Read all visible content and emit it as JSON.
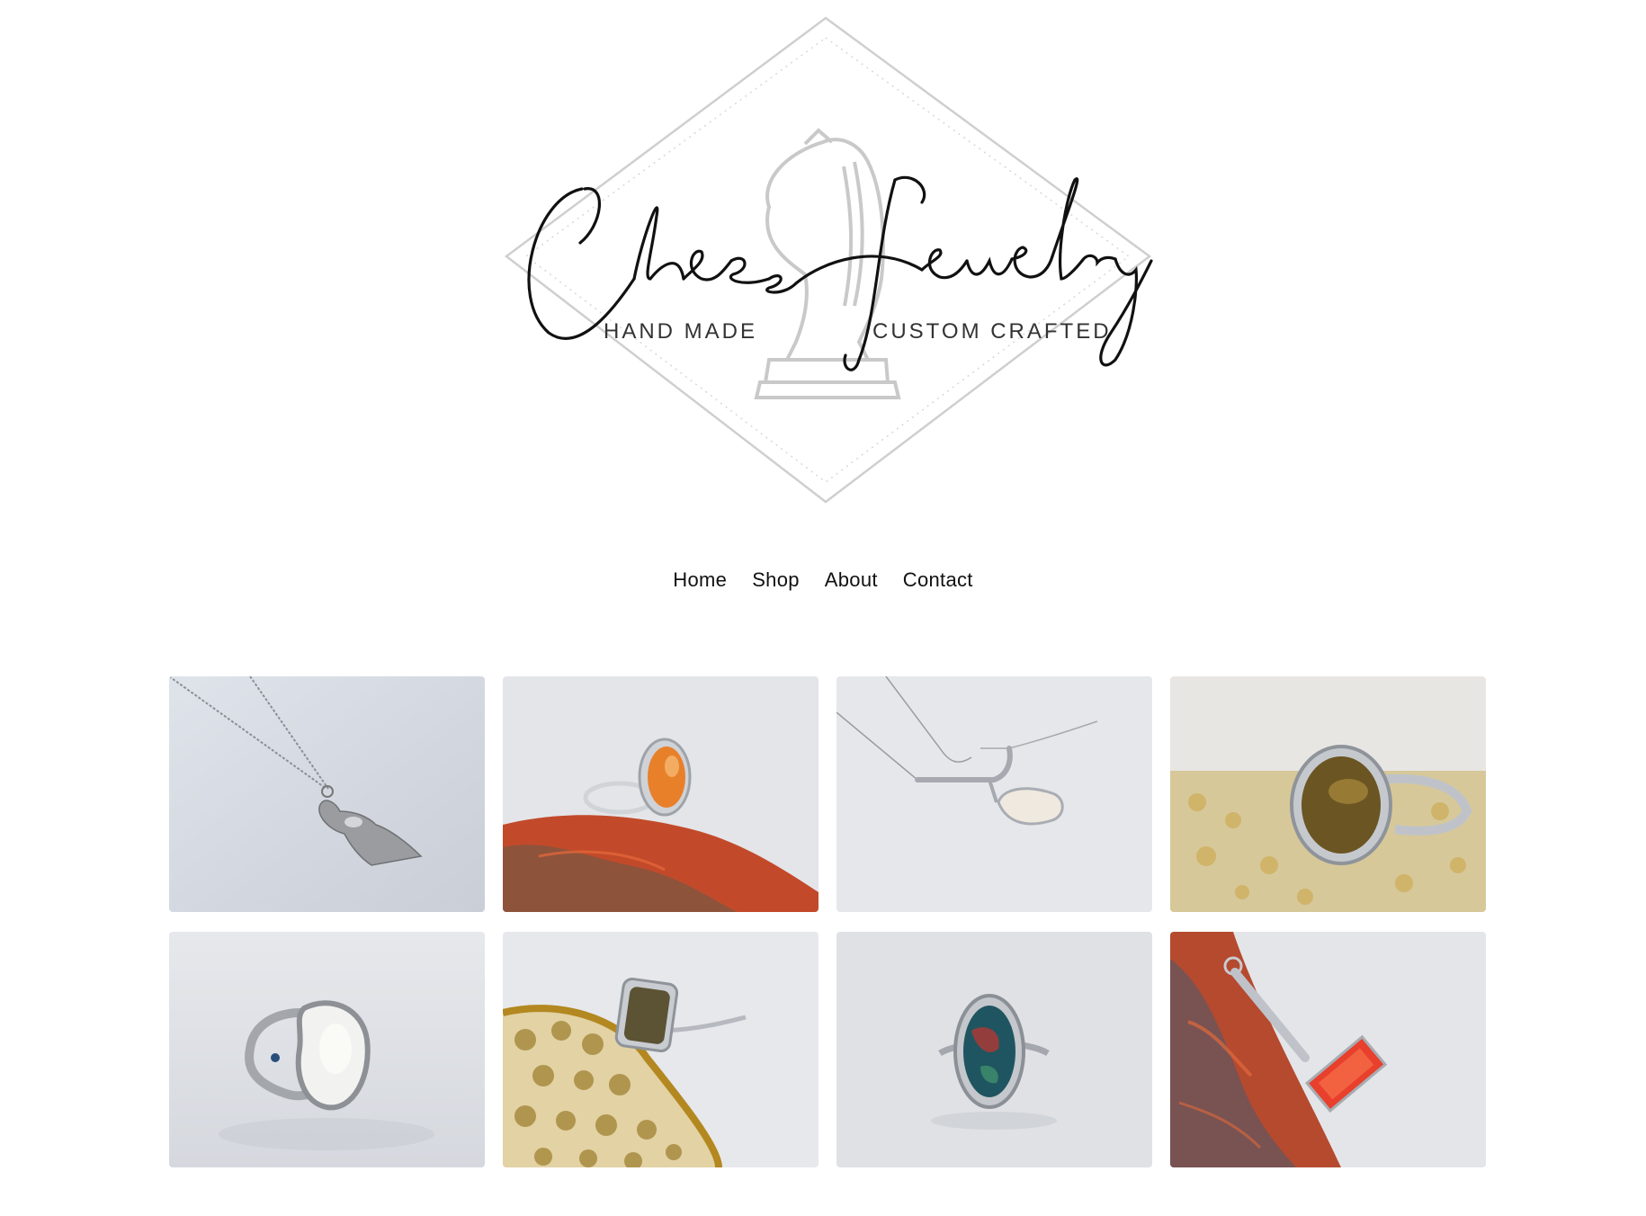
{
  "brand": {
    "logo_script": "Chess Jewelry",
    "tagline_left": "HAND MADE",
    "tagline_right": "CUSTOM CRAFTED"
  },
  "nav": {
    "items": [
      {
        "label": "Home"
      },
      {
        "label": "Shop"
      },
      {
        "label": "About"
      },
      {
        "label": "Contact"
      }
    ]
  },
  "gallery": {
    "items": [
      {
        "kind": "pendant-necklace-pawn"
      },
      {
        "kind": "carnelian-ring"
      },
      {
        "kind": "opal-bar-necklace"
      },
      {
        "kind": "tigers-eye-ring"
      },
      {
        "kind": "opal-ring"
      },
      {
        "kind": "dark-stone-ring"
      },
      {
        "kind": "bloodstone-ring"
      },
      {
        "kind": "red-crystal-pendant"
      }
    ]
  },
  "colors": {
    "background": "#ffffff",
    "text": "#111111",
    "logo_gray": "#c8c8c8"
  }
}
